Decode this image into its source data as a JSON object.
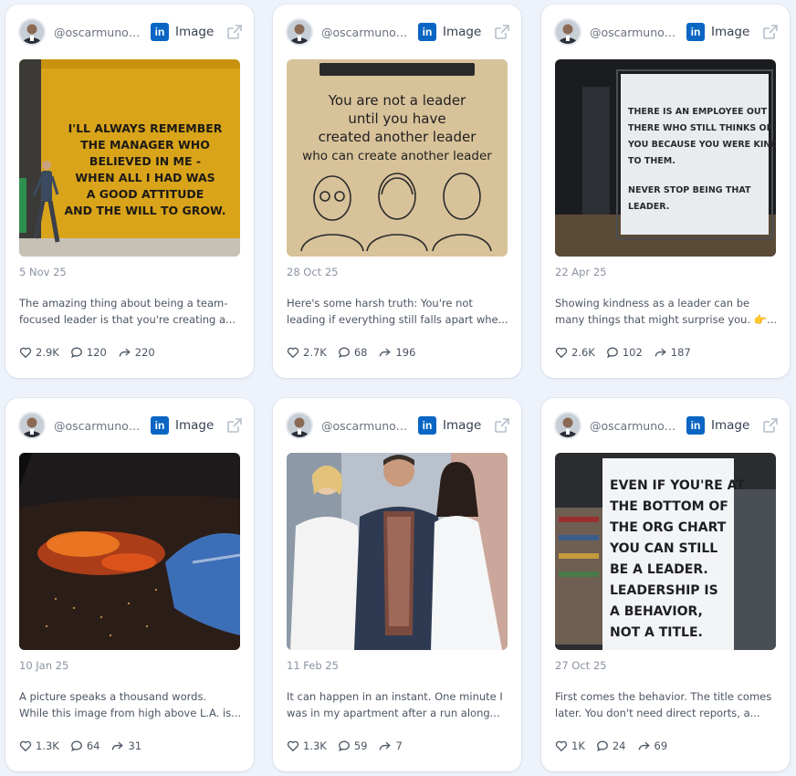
{
  "colors": {
    "linkedin": "#0a66c2",
    "background": "#eef3fb",
    "card": "#ffffff"
  },
  "icons": {
    "network": "linkedin-icon",
    "open": "external-link-icon",
    "likes": "heart-icon",
    "comments": "comment-icon",
    "shares": "share-icon"
  },
  "posts": [
    {
      "handle": "@oscarmunoz...",
      "network_glyph": "in",
      "type": "Image",
      "date": "5 Nov 25",
      "text_line1": "The amazing thing about being a team-",
      "text_line2": "focused leader is that you're creating a...",
      "likes": "2.9K",
      "comments": "120",
      "shares": "220",
      "image_text": [
        "I'LL ALWAYS REMEMBER",
        "THE MANAGER WHO",
        "BELIEVED IN ME -",
        "WHEN ALL I HAD WAS",
        "A GOOD ATTITUDE",
        "AND THE WILL TO GROW."
      ]
    },
    {
      "handle": "@oscarmunoz...",
      "network_glyph": "in",
      "type": "Image",
      "date": "28 Oct 25",
      "text_line1": "Here's some harsh truth:  You're not",
      "text_line2": "leading if everything still falls apart whe...",
      "likes": "2.7K",
      "comments": "68",
      "shares": "196",
      "image_text": [
        "You are not a leader",
        "until you have",
        "created another leader",
        "who can create another leader"
      ]
    },
    {
      "handle": "@oscarmunoz...",
      "network_glyph": "in",
      "type": "Image",
      "date": "22 Apr 25",
      "text_line1": "Showing kindness as a leader can be",
      "text_line2": "many things that might surprise you. 👉...",
      "likes": "2.6K",
      "comments": "102",
      "shares": "187",
      "image_text": [
        "THERE IS AN EMPLOYEE OUT",
        "THERE WHO STILL THINKS OF",
        "YOU BECAUSE YOU WERE KIND",
        "TO THEM.",
        "NEVER STOP BEING THAT",
        "LEADER."
      ]
    },
    {
      "handle": "@oscarmunoz...",
      "network_glyph": "in",
      "type": "Image",
      "date": "10 Jan 25",
      "text_line1": "A picture speaks a thousand words.",
      "text_line2": "While this image from high above L.A. is...",
      "likes": "1.3K",
      "comments": "64",
      "shares": "31",
      "image_text": []
    },
    {
      "handle": "@oscarmunoz...",
      "network_glyph": "in",
      "type": "Image",
      "date": "11 Feb 25",
      "text_line1": "It can happen in an instant. One minute I",
      "text_line2": "was in my apartment after a run along...",
      "likes": "1.3K",
      "comments": "59",
      "shares": "7",
      "image_text": []
    },
    {
      "handle": "@oscarmunoz...",
      "network_glyph": "in",
      "type": "Image",
      "date": "27 Oct 25",
      "text_line1": "First comes the behavior. The title comes",
      "text_line2": "later. You don't need direct reports, a...",
      "likes": "1K",
      "comments": "24",
      "shares": "69",
      "image_text": [
        "EVEN IF YOU'RE AT",
        "THE BOTTOM OF",
        "THE ORG CHART",
        "YOU CAN STILL",
        "BE A LEADER.",
        "LEADERSHIP IS",
        "A BEHAVIOR,",
        "NOT A TITLE."
      ]
    }
  ]
}
